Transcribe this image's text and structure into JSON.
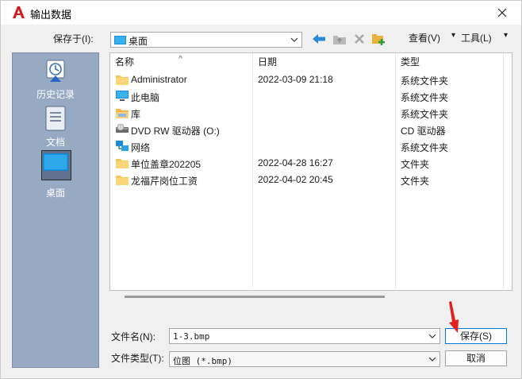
{
  "window": {
    "title": "输出数据"
  },
  "toolbar": {
    "save_in_label": "保存于(I):",
    "location": "桌面",
    "view_label": "查看(V)",
    "tools_label": "工具(L)"
  },
  "places": [
    {
      "label": "历史记录"
    },
    {
      "label": "文档"
    },
    {
      "label": "桌面"
    }
  ],
  "columns": {
    "name": "名称",
    "date": "日期",
    "type": "类型"
  },
  "files": [
    {
      "name": "Administrator",
      "date": "2022-03-09 21:18",
      "type": "系统文件夹",
      "icon": "folder-icon"
    },
    {
      "name": "此电脑",
      "date": "",
      "type": "系统文件夹",
      "icon": "computer-icon"
    },
    {
      "name": "库",
      "date": "",
      "type": "系统文件夹",
      "icon": "library-folder-icon"
    },
    {
      "name": "DVD RW 驱动器 (O:)",
      "date": "",
      "type": "CD 驱动器",
      "icon": "dvd-drive-icon"
    },
    {
      "name": "网络",
      "date": "",
      "type": "系统文件夹",
      "icon": "network-icon"
    },
    {
      "name": "单位盖章202205",
      "date": "2022-04-28 16:27",
      "type": "文件夹",
      "icon": "folder-icon"
    },
    {
      "name": "龙福芹岗位工资",
      "date": "2022-04-02 20:45",
      "type": "文件夹",
      "icon": "folder-icon"
    }
  ],
  "bottom": {
    "filename_label": "文件名(N):",
    "filename_value": "1-3.bmp",
    "filetype_label": "文件类型(T):",
    "filetype_value": "位图 (*.bmp)",
    "save_button": "保存(S)",
    "cancel_button": "取消"
  },
  "colors": {
    "places_bg": "#96aac4",
    "accent": "#0078d7",
    "folder": "#f6c55c",
    "arrow": "#e02020"
  }
}
